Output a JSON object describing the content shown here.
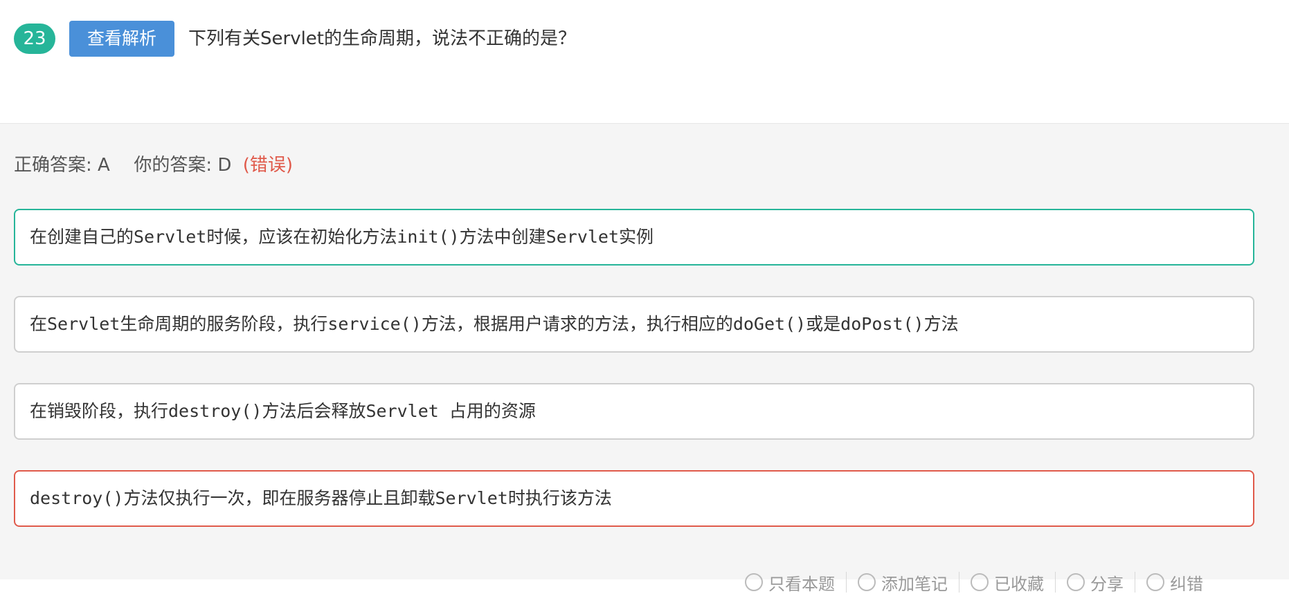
{
  "question": {
    "number": "23",
    "view_analysis_label": "查看解析",
    "text": "下列有关Servlet的生命周期，说法不正确的是？"
  },
  "result": {
    "correct_label": "正确答案:",
    "correct_value": "A",
    "your_label": "你的答案:",
    "your_value": "D",
    "status": "(错误)"
  },
  "options": [
    {
      "text": "在创建自己的Servlet时候，应该在初始化方法init()方法中创建Servlet实例",
      "state": "correct"
    },
    {
      "text": "在Servlet生命周期的服务阶段，执行service()方法，根据用户请求的方法，执行相应的doGet()或是doPost()方法",
      "state": "normal"
    },
    {
      "text": "在销毁阶段，执行destroy()方法后会释放Servlet 占用的资源",
      "state": "normal"
    },
    {
      "text": "destroy()方法仅执行一次，即在服务器停止且卸载Servlet时执行该方法",
      "state": "wrong"
    }
  ],
  "toolbar": {
    "items": [
      {
        "label": "只看本题",
        "icon": "eye-icon"
      },
      {
        "label": "添加笔记",
        "icon": "note-icon"
      },
      {
        "label": "已收藏",
        "icon": "star-icon"
      },
      {
        "label": "分享",
        "icon": "share-icon"
      },
      {
        "label": "纠错",
        "icon": "flag-icon"
      }
    ]
  },
  "colors": {
    "accent_green": "#26b599",
    "button_blue": "#4a90d9",
    "error_red": "#e05a4b"
  }
}
